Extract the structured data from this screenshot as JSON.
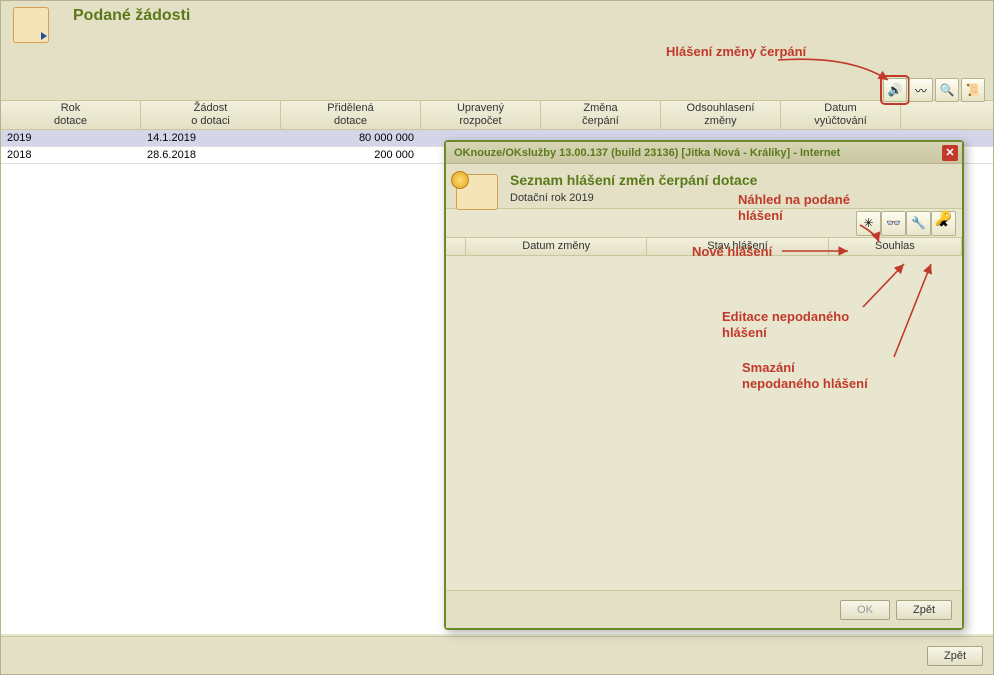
{
  "main": {
    "title": "Podané žádosti",
    "toolbar": {
      "btn_hlaseni_icon": "🔊",
      "btn2_icon": "〰",
      "btn3_icon": "🔍",
      "btn4_icon": "📜"
    },
    "columns": {
      "rok": "Rok\ndotace",
      "zadost": "Žádost\no dotaci",
      "pridelena": "Přidělená\ndotace",
      "upraveny": "Upravený\nrozpočet",
      "zmena": "Změna\nčerpání",
      "ods": "Odsouhlasení\nzměny",
      "datum": "Datum\nvyúčtování"
    },
    "rows": [
      {
        "rok": "2019",
        "zadost": "14.1.2019",
        "pridelena": "80 000 000"
      },
      {
        "rok": "2018",
        "zadost": "28.6.2018",
        "pridelena": "200 000"
      }
    ],
    "footer_back": "Zpět"
  },
  "dialog": {
    "titlebar": "OKnouze/OKslužby 13.00.137 (build 23136)  [Jitka Nová - Králíky] - Internet",
    "header_title": "Seznam hlášení změn čerpání dotace",
    "header_sub": "Dotační rok 2019",
    "toolbar": {
      "btn_new_icon": "✳",
      "btn_view_icon": "👓",
      "btn_edit_icon": "🔧",
      "btn_delete_icon": "✖"
    },
    "columns": {
      "datum": "Datum změny",
      "stav": "Stav hlášení",
      "souhlas": "Souhlas"
    },
    "footer_ok": "OK",
    "footer_back": "Zpět"
  },
  "annotations": {
    "hlaseni_zmeny": "Hlášení změny čerpání",
    "nahled": "Náhled na podané\nhlášení",
    "nove": "Nové hlášení",
    "editace": "Editace nepodaného\nhlášení",
    "smazani": "Smazání\nnepodaného hlášení"
  }
}
